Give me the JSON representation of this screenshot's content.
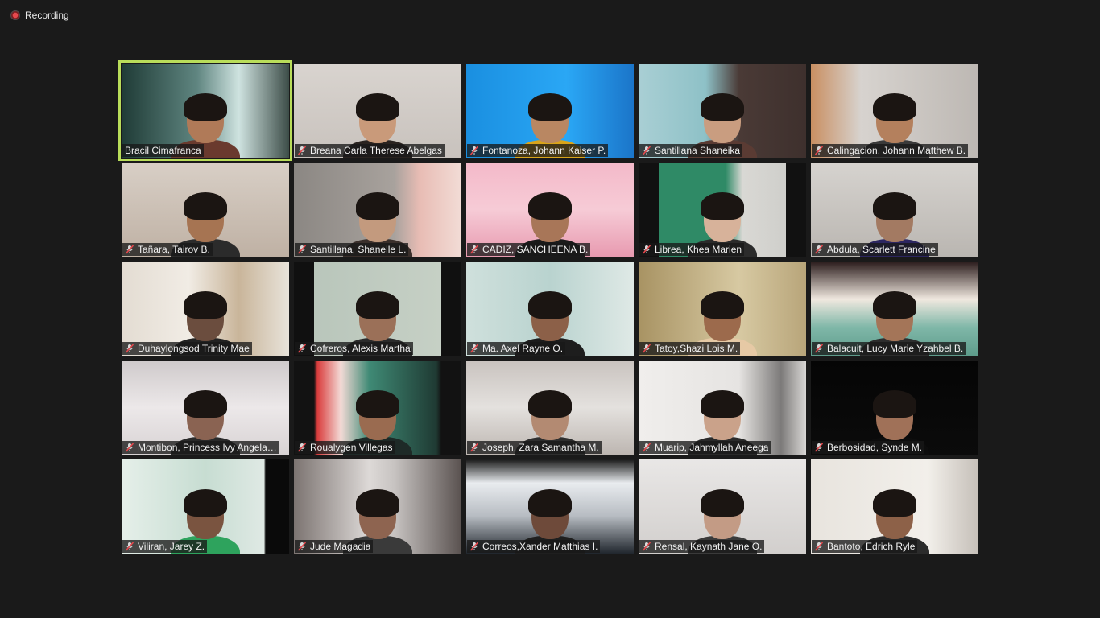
{
  "status": {
    "recording_label": "Recording"
  },
  "participants": [
    {
      "name": "Bracil Cimafranca",
      "muted": false,
      "active": true,
      "bg": "linear-gradient(90deg,#1f3b36 0%,#5f8580 45%,#cfe3e0 70%,#3d4d48 100%)",
      "skin": "#b07a58",
      "shirt": "#6a3a2e"
    },
    {
      "name": "Breana Carla Therese Abelgas",
      "muted": true,
      "active": false,
      "bg": "linear-gradient(180deg,#d9d4cf 0%,#c8c2bd 100%)",
      "skin": "#c99a7a",
      "shirt": "#2a2320"
    },
    {
      "name": "Fontanoza, Johann Kaiser P.",
      "muted": true,
      "active": false,
      "bg": "linear-gradient(90deg,#1a8fe0 0%,#2aa7f5 60%,#1b75c9 100%)",
      "skin": "#b98762",
      "shirt": "#d9a41a"
    },
    {
      "name": "Santillana Shaneika",
      "muted": true,
      "active": false,
      "bg": "linear-gradient(90deg,#a9cfd4 0%,#8ec1c7 40%,#4a3a36 60%,#3e302d 100%)",
      "skin": "#c99d80",
      "shirt": "#5a3b33"
    },
    {
      "name": "Calingacion, Johann Matthew B.",
      "muted": true,
      "active": false,
      "bg": "linear-gradient(90deg,#c98f62 0%,#d7d3cf 30%,#bdb8b3 100%)",
      "skin": "#b4805d",
      "shirt": "#3a3a3a"
    },
    {
      "name": "Tañara, Tairov B.",
      "muted": true,
      "active": false,
      "bg": "linear-gradient(180deg,#d8cfc6 0%,#bfb1a4 100%)",
      "skin": "#a67452",
      "shirt": "#2b2b2b"
    },
    {
      "name": "Santillana, Shanelle L.",
      "muted": true,
      "active": false,
      "bg": "linear-gradient(90deg,#8b8783 0%,#a8a29d 60%,#e8bcb4 75%,#f2dcd6 100%)",
      "skin": "#c39a7e",
      "shirt": "#3a2f2b"
    },
    {
      "name": "CADIZ, SANCHEENA B.",
      "muted": true,
      "active": false,
      "bg": "linear-gradient(180deg,#f4b9c9 0%,#f6cbd6 50%,#e89ab0 100%)",
      "skin": "#a87658",
      "shirt": "#1b1b1b"
    },
    {
      "name": "Librea, Khea Marien",
      "muted": true,
      "active": false,
      "bg": "linear-gradient(90deg,#111 0%,#111 12%,#2f8a66 12%,#2f8a66 52%,#d9d8d4 62%,#cfcfcb 88%,#111 88%)",
      "skin": "#d7b29a",
      "shirt": "#2b2b2b"
    },
    {
      "name": "Abdula, Scarlett Francine",
      "muted": true,
      "active": false,
      "bg": "linear-gradient(180deg,#d6d3cf 0%,#bab6b1 100%)",
      "skin": "#a37a62",
      "shirt": "#2c2660"
    },
    {
      "name": "Duhaylongsod Trinity Mae",
      "muted": true,
      "active": false,
      "bg": "linear-gradient(90deg,#e3dcd2 0%,#f1ece5 40%,#c9b59a 70%,#e8e3da 100%)",
      "skin": "#6b4d3e",
      "shirt": "#222"
    },
    {
      "name": "Cofreros, Alexis Martha",
      "muted": true,
      "active": false,
      "bg": "linear-gradient(90deg,#101010 0%,#101010 12%,#b9c6bb 12%,#c6d0c5 88%,#101010 88%)",
      "skin": "#9b7058",
      "shirt": "#2b2b2b"
    },
    {
      "name": "Ma. Axel Rayne O.",
      "muted": true,
      "active": false,
      "bg": "linear-gradient(90deg,#cfe0dc 0%,#b9d3cf 50%,#dfe9e6 100%)",
      "skin": "#8c6048",
      "shirt": "#1d1d1d"
    },
    {
      "name": "Tatoy,Shazi Lois M.",
      "muted": true,
      "active": false,
      "bg": "linear-gradient(90deg,#a89363 0%,#d7c9a2 60%,#b8a57a 100%)",
      "skin": "#9c6a4c",
      "shirt": "#e6c9a5"
    },
    {
      "name": "Balacuit, Lucy Marie Yzahbel B.",
      "muted": true,
      "active": false,
      "bg": "linear-gradient(180deg,#2a1b1b 0%,#f0e8df 40%,#7fb7a8 70%,#5e9c8b 100%)",
      "skin": "#a47558",
      "shirt": "#2d2d2d"
    },
    {
      "name": "Montibon, Princess Ivy Angela…",
      "muted": true,
      "active": false,
      "bg": "linear-gradient(180deg,#cfcacb 0%,#ece8e9 50%,#d8d3d4 100%)",
      "skin": "#8a6352",
      "shirt": "#2a2a2a"
    },
    {
      "name": "Roualygen Villegas",
      "muted": true,
      "active": false,
      "bg": "linear-gradient(90deg,#121212 0%,#121212 12%,#d93c3c 14%,#f3dad6 28%,#3f8a75 45%,#1f3a33 85%,#121212 88%)",
      "skin": "#9a6b50",
      "shirt": "#1e2a27"
    },
    {
      "name": "Joseph, Zara Samantha M.",
      "muted": true,
      "active": false,
      "bg": "linear-gradient(180deg,#c9c3bf 0%,#e4e1de 50%,#bdb6b1 100%)",
      "skin": "#b38a72",
      "shirt": "#2e2e2e"
    },
    {
      "name": "Muarip, Jahmyllah Aneega",
      "muted": true,
      "active": false,
      "bg": "linear-gradient(90deg,#f0eeec 0%,#e6e4e2 60%,#7c7a79 85%,#d9d7d5 100%)",
      "skin": "#caa28a",
      "shirt": "#2a2a2a"
    },
    {
      "name": "Berbosidad, Synde M.",
      "muted": true,
      "active": false,
      "bg": "linear-gradient(180deg,#050505 0%,#0b0b0b 100%)",
      "skin": "#a07158",
      "shirt": "#0d0d0d"
    },
    {
      "name": "Viliran, Jarey Z.",
      "muted": true,
      "active": false,
      "bg": "linear-gradient(90deg,#e5efe9 0%,#c7ddd2 50%,#dfe9e4 85%,#0a0a0a 86%)",
      "skin": "#7a5440",
      "shirt": "#2ea35d"
    },
    {
      "name": "Jude Magadia",
      "muted": true,
      "active": false,
      "bg": "linear-gradient(90deg,#7c7471 0%,#ddd9d7 45%,#c7c3c1 60%,#5a5250 100%)",
      "skin": "#8e6450",
      "shirt": "#3a3a3a"
    },
    {
      "name": "Correos,Xander Matthias I.",
      "muted": true,
      "active": false,
      "bg": "linear-gradient(180deg,#1a1a1a 0%,#e9ecef 25%,#b7bcc2 60%,#20262d 100%)",
      "skin": "#6e4a3a",
      "shirt": "#1f1f1f"
    },
    {
      "name": "Rensal, Kaynath Jane O.",
      "muted": true,
      "active": false,
      "bg": "linear-gradient(180deg,#e9e7e6 0%,#d2cfcd 100%)",
      "skin": "#c39b85",
      "shirt": "#3a3a3a"
    },
    {
      "name": "Bantoto, Edrich Ryle",
      "muted": true,
      "active": false,
      "bg": "linear-gradient(90deg,#e8e4de 0%,#f2efea 70%,#c5bfb8 100%)",
      "skin": "#8d6148",
      "shirt": "#2b2b2b"
    }
  ]
}
